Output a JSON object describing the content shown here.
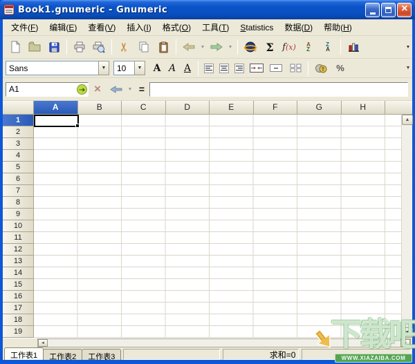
{
  "window": {
    "title": "Book1.gnumeric - Gnumeric"
  },
  "menu": {
    "items": [
      {
        "pre": "文件(",
        "key": "F",
        "post": ")"
      },
      {
        "pre": "编辑(",
        "key": "E",
        "post": ")"
      },
      {
        "pre": "查看(",
        "key": "V",
        "post": ")"
      },
      {
        "pre": "插入(",
        "key": "I",
        "post": ")"
      },
      {
        "pre": "格式(",
        "key": "O",
        "post": ")"
      },
      {
        "pre": "工具(",
        "key": "T",
        "post": ")"
      },
      {
        "pre": "",
        "key": "S",
        "post": "tatistics"
      },
      {
        "pre": "数据(",
        "key": "D",
        "post": ")"
      },
      {
        "pre": "帮助(",
        "key": "H",
        "post": ")"
      }
    ]
  },
  "toolbar": {
    "sigma": "Σ",
    "fn_f": "f",
    "fn_args": "(x)",
    "sort_az_top": "A",
    "sort_az_bottom": "Z",
    "sort_za_top": "Z",
    "sort_za_bottom": "A"
  },
  "format_bar": {
    "font_name": "Sans",
    "font_size": "10",
    "bold_label": "A",
    "italic_label": "A",
    "underline_label": "A",
    "percent_label": "%"
  },
  "formula_bar": {
    "cell_ref": "A1",
    "equals_label": "=",
    "formula_value": ""
  },
  "grid": {
    "columns": [
      "A",
      "B",
      "C",
      "D",
      "E",
      "F",
      "G",
      "H"
    ],
    "rows": [
      1,
      2,
      3,
      4,
      5,
      6,
      7,
      8,
      9,
      10,
      11,
      12,
      13,
      14,
      15,
      16,
      17,
      18,
      19
    ],
    "selected_column": "A",
    "selected_row": 1,
    "selected_cell": "A1"
  },
  "sheet_tabs": {
    "tabs": [
      "工作表1",
      "工作表2",
      "工作表3"
    ],
    "active_index": 0
  },
  "status_bar": {
    "sum_text": "求和=0"
  },
  "watermark": {
    "name": "下载吧",
    "site": "WWW.XIAZAIBA.COM"
  },
  "icons": {
    "cut_glyph": "✂",
    "dropdown_glyph": "▼",
    "up_arrow_glyph": "▲",
    "down_arrow_glyph": "▼",
    "left_arrow_glyph": "◄",
    "right_arrow_glyph": "►",
    "cancel_glyph": "×",
    "close_glyph": "×"
  },
  "colors": {
    "titlebar_blue": "#0A50C2",
    "selection_blue": "#2A5AB6",
    "toolbar_beige": "#ECE9D8",
    "watermark_green": "#55A455",
    "close_red": "#CC4528"
  }
}
